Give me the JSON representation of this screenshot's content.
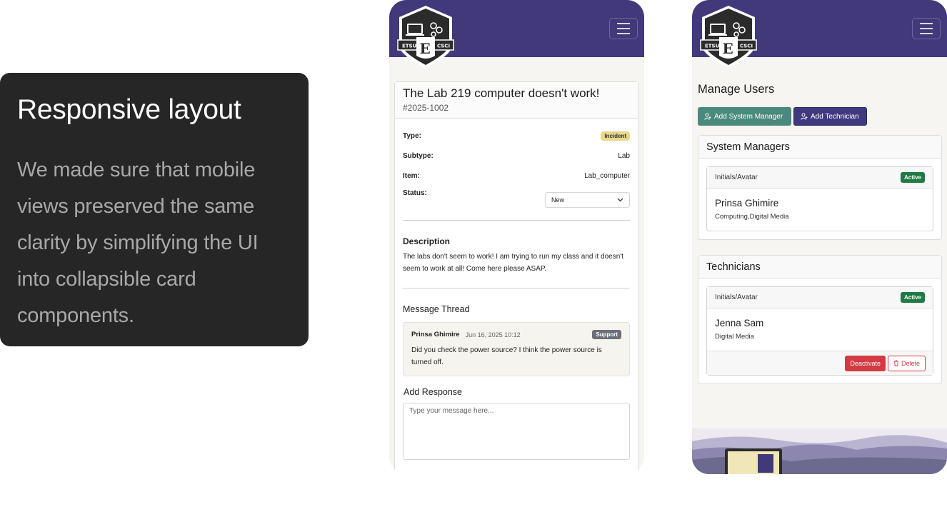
{
  "info": {
    "title": "Responsive layout",
    "body": "We made sure that mobile views preserved the same clarity by simplifying the UI into collapsible card components."
  },
  "brand": {
    "logo_left": "ETSU",
    "logo_right": "CSCI",
    "logo_letter": "E",
    "accent": "#41397a"
  },
  "ticket": {
    "title": "The Lab 219 computer doesn't work!",
    "id": "#2025-1002",
    "fields": {
      "type_label": "Type:",
      "type_value": "Incident",
      "subtype_label": "Subtype:",
      "subtype_value": "Lab",
      "item_label": "Item:",
      "item_value": "Lab_computer",
      "status_label": "Status:",
      "status_value": "New"
    },
    "description_label": "Description",
    "description": "The labs don't seem to work! I am trying to run my class and it doesn't seem to work at all! Come here please ASAP.",
    "thread_label": "Message Thread",
    "message": {
      "author": "Prinsa Ghimire",
      "date": "Jun 16, 2025 10:12",
      "role": "Support",
      "text": "Did you check the power source? I think the power source is turned off."
    },
    "add_response_label": "Add Response",
    "reply_placeholder": "Type your message here..."
  },
  "manage": {
    "title": "Manage Users",
    "add_manager_label": "Add System Manager",
    "add_technician_label": "Add Technician",
    "system_managers": {
      "heading": "System Managers",
      "card_header": "Initials/Avatar",
      "status": "Active",
      "name": "Prinsa Ghimire",
      "dept": "Computing,Digital Media"
    },
    "technicians": {
      "heading": "Technicians",
      "card_header": "Initials/Avatar",
      "status": "Active",
      "name": "Jenna Sam",
      "dept": "Digital Media",
      "deactivate_label": "Deactivate",
      "delete_label": "Delete"
    }
  }
}
